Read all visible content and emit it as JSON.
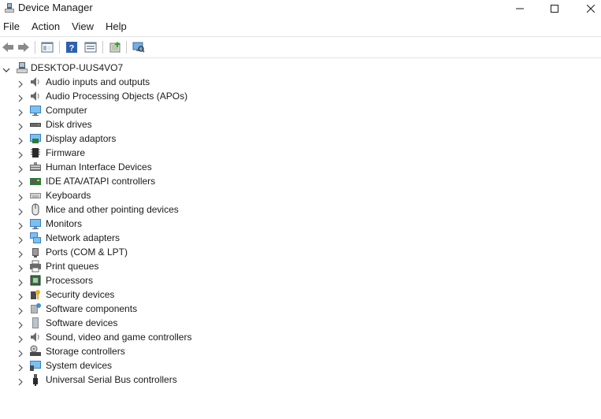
{
  "window": {
    "title": "Device Manager"
  },
  "menu": {
    "items": [
      "File",
      "Action",
      "View",
      "Help"
    ]
  },
  "tree": {
    "root_label": "DESKTOP-UUS4VO7",
    "items": [
      {
        "label": "Audio inputs and outputs",
        "icon": "speaker-icon"
      },
      {
        "label": "Audio Processing Objects (APOs)",
        "icon": "speaker-icon"
      },
      {
        "label": "Computer",
        "icon": "computer-icon"
      },
      {
        "label": "Disk drives",
        "icon": "disk-drive-icon"
      },
      {
        "label": "Display adaptors",
        "icon": "display-adapter-icon"
      },
      {
        "label": "Firmware",
        "icon": "firmware-icon"
      },
      {
        "label": "Human Interface Devices",
        "icon": "hid-icon"
      },
      {
        "label": "IDE ATA/ATAPI controllers",
        "icon": "ide-controller-icon"
      },
      {
        "label": "Keyboards",
        "icon": "keyboard-icon"
      },
      {
        "label": "Mice and other pointing devices",
        "icon": "mouse-icon"
      },
      {
        "label": "Monitors",
        "icon": "monitor-icon"
      },
      {
        "label": "Network adapters",
        "icon": "network-adapter-icon"
      },
      {
        "label": "Ports (COM & LPT)",
        "icon": "port-icon"
      },
      {
        "label": "Print queues",
        "icon": "printer-icon"
      },
      {
        "label": "Processors",
        "icon": "processor-icon"
      },
      {
        "label": "Security devices",
        "icon": "security-device-icon"
      },
      {
        "label": "Software components",
        "icon": "software-component-icon"
      },
      {
        "label": "Software devices",
        "icon": "software-device-icon"
      },
      {
        "label": "Sound, video and game controllers",
        "icon": "speaker-icon"
      },
      {
        "label": "Storage controllers",
        "icon": "storage-controller-icon"
      },
      {
        "label": "System devices",
        "icon": "system-device-icon"
      },
      {
        "label": "Universal Serial Bus controllers",
        "icon": "usb-icon"
      }
    ]
  }
}
